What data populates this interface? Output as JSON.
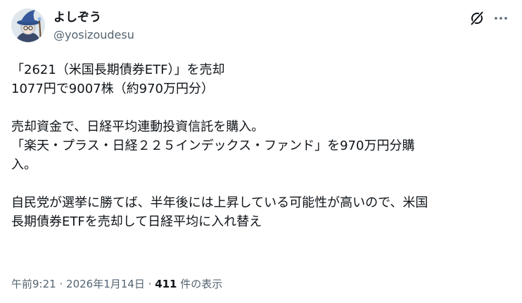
{
  "post": {
    "author_name": "よしぞう",
    "author_handle": "@yosizoudesu",
    "lines": [
      "「2621（米国長期債券ETF）」を売却",
      "1077円で9007株（約970万円分）",
      "",
      "売却資金で、日経平均連動投資信託を購入。",
      "「楽天・プラス・日経２２５インデックス・ファンド」を970万円分購",
      "入。",
      "",
      "自民党が選挙に勝てば、半年後には上昇している可能性が高いので、米国",
      "長期債券ETFを売却して日経平均に入れ替え"
    ],
    "time": "午前9:21",
    "date": "2026年1月14日",
    "separator": "·",
    "views_count": "411",
    "views_label": "件の表示"
  },
  "icons": {
    "grok": "grok-icon",
    "more": "more-icon",
    "avatar": "avatar-wizard-character"
  },
  "colors": {
    "text": "#0f1419",
    "secondary": "#536471",
    "background": "#ffffff"
  }
}
